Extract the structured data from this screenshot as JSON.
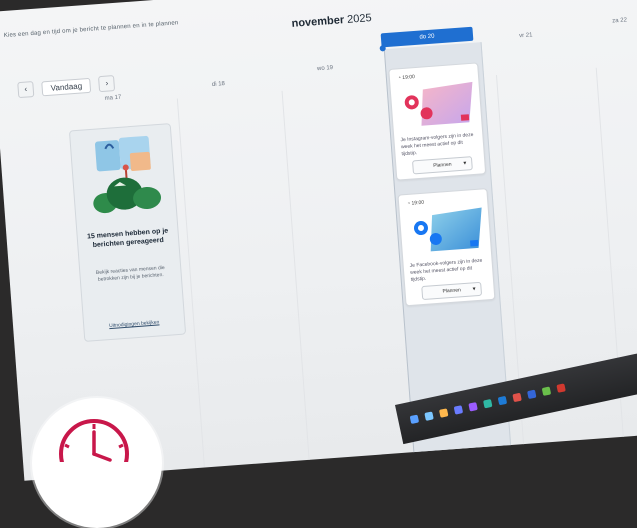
{
  "banner_text": "Kies een dag en tijd om je bericht te plannen en in te plannen",
  "calendar": {
    "month": "november",
    "year": "2025",
    "today_label": "Vandaag",
    "prev_icon": "chevron-left-icon",
    "next_icon": "chevron-right-icon",
    "today_tab": "do 20",
    "days": [
      "ma 17",
      "di 18",
      "wo 19",
      "vr 21",
      "za 22"
    ]
  },
  "promo_card": {
    "title": "15 mensen hebben op je berichten gereageerd",
    "body": "Bekijk reacties van mensen die betrokken zijn bij je berichten.",
    "link": "Uitnodigingen bekijken"
  },
  "slots": [
    {
      "time": "19:00",
      "description": "Je Instagram-volgers zijn in deze week het meest actief op dit tijdstip.",
      "plan_label": "Plannen",
      "platform_icon": "instagram-icon",
      "accent": "#e2335b"
    },
    {
      "time": "19:00",
      "description": "Je Facebook-volgers zijn in deze week het meest actief op dit tijdstip.",
      "plan_label": "Plannen",
      "platform_icon": "facebook-icon",
      "accent": "#1877f2"
    }
  ],
  "clock_badge": {
    "icon": "clock-icon",
    "color": "#c8174a"
  }
}
